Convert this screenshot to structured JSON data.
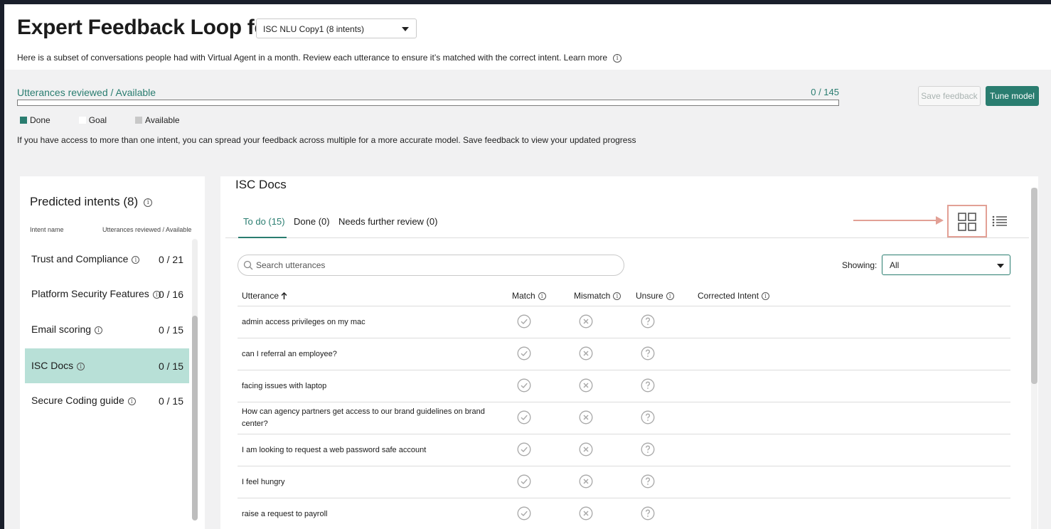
{
  "header": {
    "title": "Expert Feedback Loop for",
    "model_select": "ISC NLU Copy1 (8 intents)",
    "subtitle": "Here is a subset of conversations people had with Virtual Agent in a month. Review each utterance to ensure it’s matched with the correct intent. Learn more"
  },
  "progress": {
    "label": "Utterances reviewed / Available",
    "count": "0 / 145",
    "reviewed": 0,
    "available": 145
  },
  "actions": {
    "save_feedback": "Save feedback",
    "tune_model": "Tune model"
  },
  "legend": {
    "done": "Done",
    "goal": "Goal",
    "available": "Available"
  },
  "hint": "If you have access to more than one intent, you can spread your feedback across multiple for a more accurate model. Save feedback to view your updated progress",
  "intents_panel": {
    "title": "Predicted intents (8)",
    "col_name": "Intent name",
    "col_reviewed": "Utterances reviewed / Available",
    "items": [
      {
        "name": "Trust and Compliance",
        "count": "0 / 21",
        "active": false
      },
      {
        "name": "Platform Security Features",
        "count": "0 / 16",
        "active": false
      },
      {
        "name": "Email scoring",
        "count": "0 / 15",
        "active": false
      },
      {
        "name": "ISC Docs",
        "count": "0 / 15",
        "active": true
      },
      {
        "name": "Secure Coding guide",
        "count": "0 / 15",
        "active": false
      }
    ]
  },
  "main": {
    "title": "ISC Docs",
    "tabs": [
      "To do (15)",
      "Done (0)",
      "Needs further review (0)"
    ],
    "active_tab": 0,
    "search_placeholder": "Search utterances",
    "showing_label": "Showing:",
    "showing_value": "All",
    "columns": {
      "utterance": "Utterance",
      "match": "Match",
      "mismatch": "Mismatch",
      "unsure": "Unsure",
      "corrected_intent": "Corrected Intent"
    },
    "rows": [
      {
        "utterance": "admin access privileges on my mac"
      },
      {
        "utterance": "can I referral an employee?"
      },
      {
        "utterance": "facing issues with laptop"
      },
      {
        "utterance": "How can agency partners get access to our brand guidelines on brand center?"
      },
      {
        "utterance": "I am looking to request a web password safe account"
      },
      {
        "utterance": "I feel hungry"
      },
      {
        "utterance": "raise a request to payroll"
      }
    ]
  },
  "colors": {
    "accent": "#2a7d70",
    "active_intent_bg": "#b8e0d7",
    "highlight": "#e2a095"
  },
  "icons": {
    "info": "info-circle-icon",
    "grid_view": "grid-view-icon",
    "list_view": "list-view-icon",
    "match": "check-circle-icon",
    "mismatch": "x-circle-icon",
    "unsure": "question-circle-icon",
    "search": "search-icon",
    "sort": "arrow-up-icon"
  }
}
